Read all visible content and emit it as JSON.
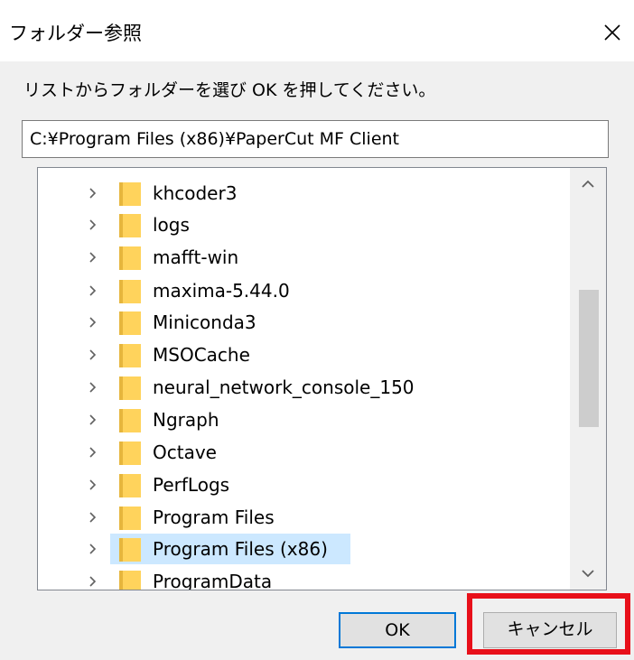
{
  "dialog": {
    "title": "フォルダー参照",
    "close_icon": "close-icon",
    "instruction": "リストからフォルダーを選び OK を押してください。",
    "path_value": "C:¥Program Files (x86)¥PaperCut MF Client"
  },
  "tree": {
    "items": [
      {
        "label": "khcoder3",
        "selected": false
      },
      {
        "label": "logs",
        "selected": false
      },
      {
        "label": "mafft-win",
        "selected": false
      },
      {
        "label": "maxima-5.44.0",
        "selected": false
      },
      {
        "label": "Miniconda3",
        "selected": false
      },
      {
        "label": "MSOCache",
        "selected": false
      },
      {
        "label": "neural_network_console_150",
        "selected": false
      },
      {
        "label": "Ngraph",
        "selected": false
      },
      {
        "label": "Octave",
        "selected": false
      },
      {
        "label": "PerfLogs",
        "selected": false
      },
      {
        "label": "Program Files",
        "selected": false
      },
      {
        "label": "Program Files (x86)",
        "selected": true
      },
      {
        "label": "ProgramData",
        "selected": false
      }
    ]
  },
  "buttons": {
    "ok_label": "OK",
    "cancel_label": "キャンセル"
  },
  "colors": {
    "selection": "#cce8ff",
    "folder": "#ffd35c",
    "default_button_border": "#0078d7",
    "highlight": "#e8101a"
  }
}
